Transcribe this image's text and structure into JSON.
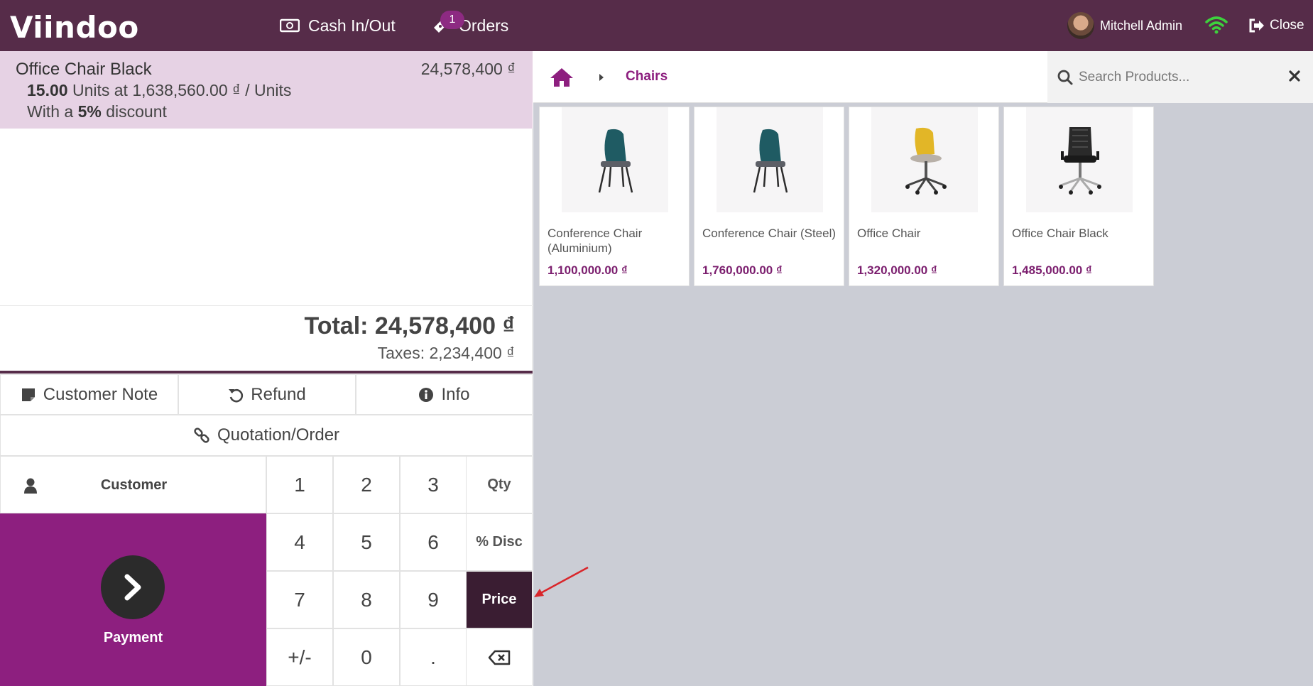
{
  "navbar": {
    "logo": "Viindoo",
    "cash_label": "Cash In/Out",
    "orders_label": "Orders",
    "orders_badge": "1",
    "user_name": "Mitchell Admin",
    "close_label": "Close"
  },
  "order": {
    "line": {
      "name": "Office Chair Black",
      "price": "24,578,400 ₫",
      "qty": "15.00",
      "unit_text": "Units at 1,638,560.00 ₫ / Units",
      "discount_prefix": "With a",
      "discount": "5%",
      "discount_suffix": "discount"
    },
    "total": "Total: 24,578,400 ₫",
    "taxes": "Taxes: 2,234,400 ₫"
  },
  "controls": {
    "customer_note": "Customer Note",
    "refund": "Refund",
    "info": "Info",
    "quotation": "Quotation/Order",
    "customer": "Customer",
    "payment": "Payment"
  },
  "numpad": {
    "k1": "1",
    "k2": "2",
    "k3": "3",
    "k4": "4",
    "k5": "5",
    "k6": "6",
    "k7": "7",
    "k8": "8",
    "k9": "9",
    "plusminus": "+/-",
    "k0": "0",
    "dot": ".",
    "qty": "Qty",
    "disc": "% Disc",
    "price": "Price"
  },
  "products": {
    "breadcrumb": "Chairs",
    "search_placeholder": "Search Products...",
    "items": [
      {
        "name": "Conference Chair (Aluminium)",
        "price": "1,100,000.00 ₫"
      },
      {
        "name": "Conference Chair (Steel)",
        "price": "1,760,000.00 ₫"
      },
      {
        "name": "Office Chair",
        "price": "1,320,000.00 ₫"
      },
      {
        "name": "Office Chair Black",
        "price": "1,485,000.00 ₫"
      }
    ]
  },
  "colors": {
    "navbar": "#562c49",
    "accent": "#8d1f7f",
    "active_key": "#3a1d32",
    "selected_line": "#e6d2e4",
    "annotation_arrow": "#d9262b"
  }
}
